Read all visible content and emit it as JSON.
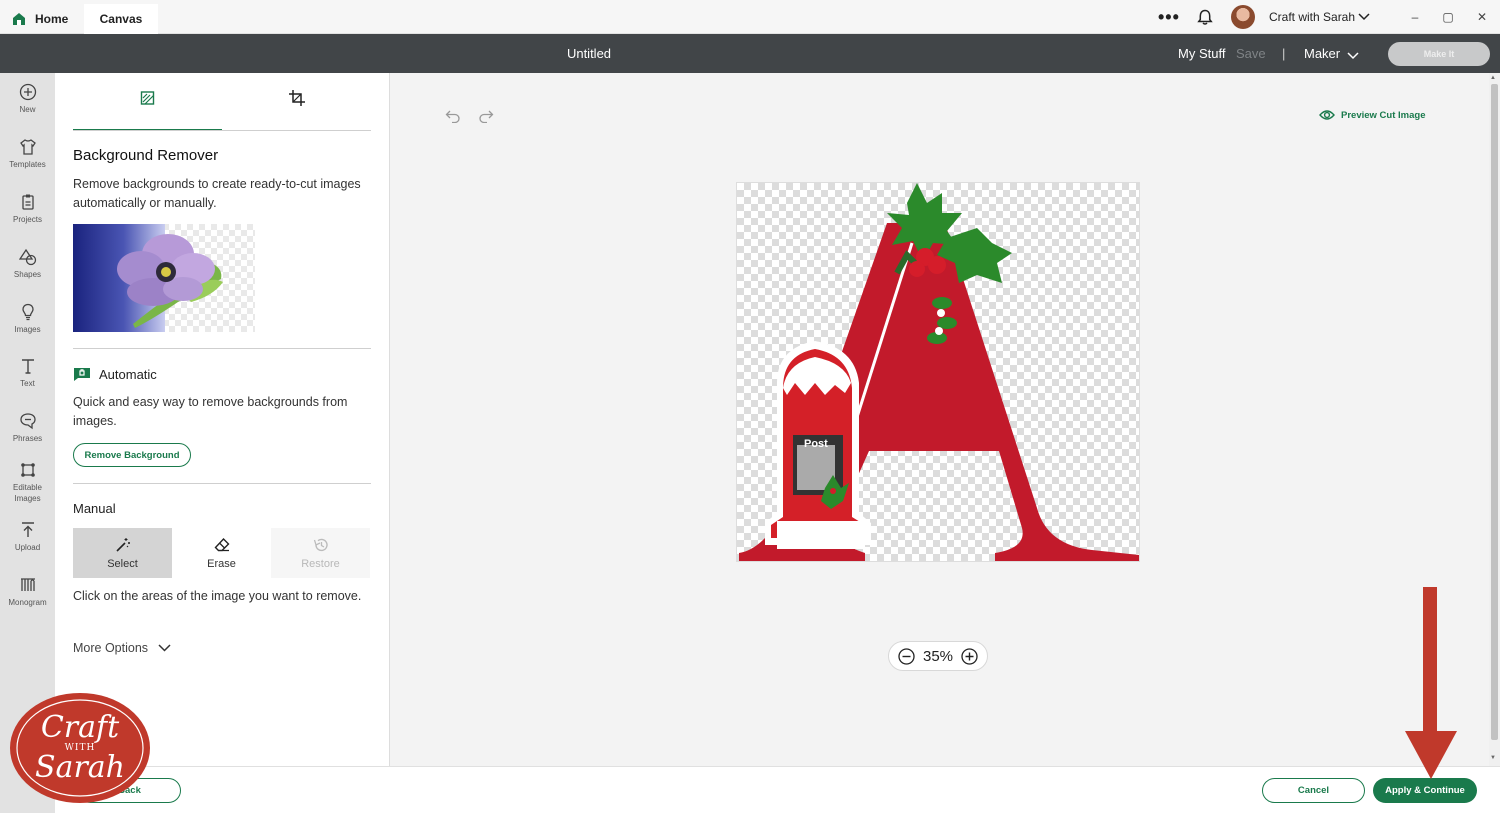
{
  "tabs": {
    "home": "Home",
    "canvas": "Canvas"
  },
  "account": {
    "name": "Craft with Sarah",
    "more": "•••"
  },
  "window": {
    "minimize": "–",
    "maximize": "▢",
    "close": "✕"
  },
  "header": {
    "title": "Untitled",
    "my_stuff": "My Stuff",
    "save": "Save",
    "separator": "|",
    "machine": "Maker",
    "make_it": "Make It"
  },
  "nav": [
    {
      "label": "New",
      "icon": "plus-circle-icon"
    },
    {
      "label": "Templates",
      "icon": "tshirt-icon"
    },
    {
      "label": "Projects",
      "icon": "clipboard-icon"
    },
    {
      "label": "Shapes",
      "icon": "shapes-icon"
    },
    {
      "label": "Images",
      "icon": "lightbulb-icon"
    },
    {
      "label": "Text",
      "icon": "text-icon"
    },
    {
      "label": "Phrases",
      "icon": "speech-bubble-icon"
    },
    {
      "label": "Editable Images",
      "icon": "editable-images-icon"
    },
    {
      "label": "Upload",
      "icon": "upload-icon"
    },
    {
      "label": "Monogram",
      "icon": "monogram-icon"
    }
  ],
  "panel": {
    "title": "Background Remover",
    "description": "Remove backgrounds to create ready-to-cut images automatically or manually.",
    "automatic": {
      "label": "Automatic",
      "description": "Quick and easy way to remove backgrounds from images.",
      "button": "Remove Background"
    },
    "manual": {
      "label": "Manual",
      "tools": [
        {
          "label": "Select",
          "icon": "magic-wand-icon",
          "state": "active"
        },
        {
          "label": "Erase",
          "icon": "eraser-icon",
          "state": "default"
        },
        {
          "label": "Restore",
          "icon": "history-icon",
          "state": "disabled"
        }
      ],
      "description": "Click on the areas of the image you want to remove."
    },
    "more_options": "More Options"
  },
  "canvas": {
    "preview_label": "Preview Cut Image",
    "zoom": "35%"
  },
  "footer": {
    "back": "Back",
    "cancel": "Cancel",
    "apply": "Apply & Continue"
  },
  "overlay": {
    "logo_line1": "Craft",
    "logo_with": "WITH",
    "logo_line2": "Sarah"
  },
  "colors": {
    "accent": "#1a7a4c",
    "header": "#414548",
    "annotation": "#c0392b"
  }
}
